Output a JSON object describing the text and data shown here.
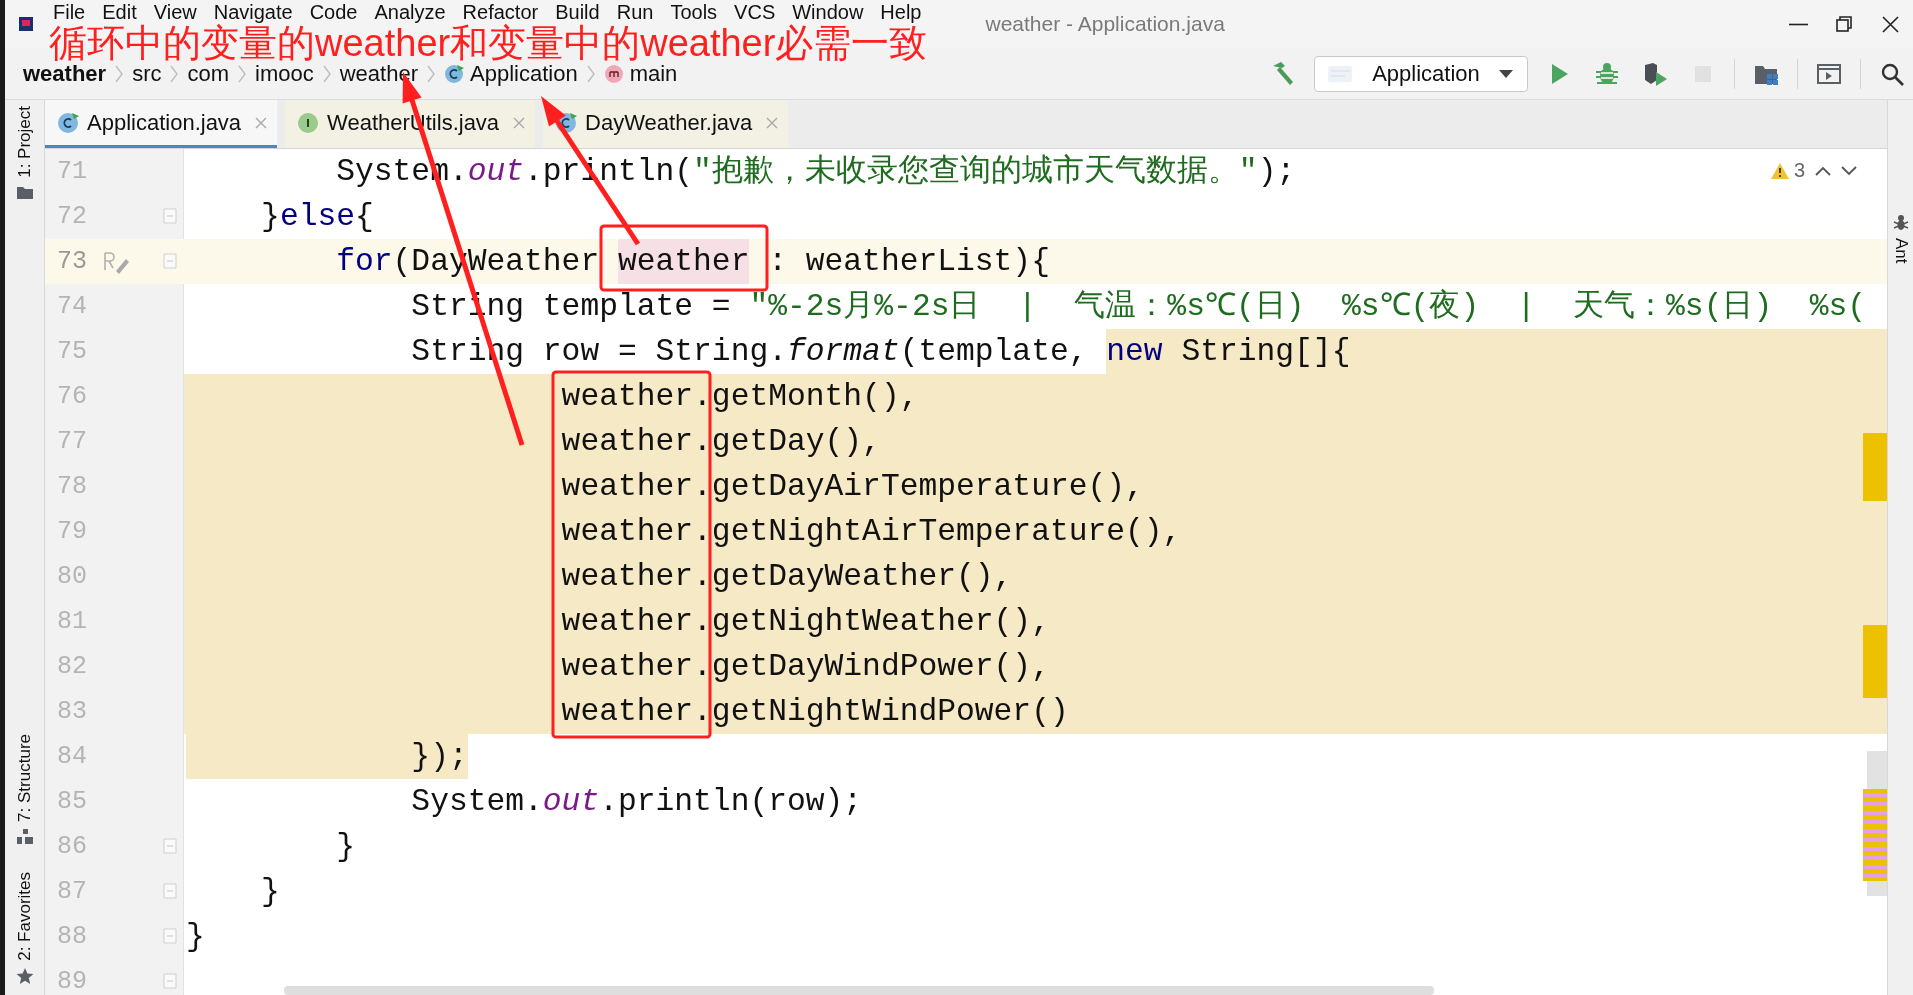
{
  "window": {
    "title": "weather - Application.java"
  },
  "menu": [
    "File",
    "Edit",
    "View",
    "Navigate",
    "Code",
    "Analyze",
    "Refactor",
    "Build",
    "Run",
    "Tools",
    "VCS",
    "Window",
    "Help"
  ],
  "annotation": {
    "text": "循环中的变量的weather和变量中的weather必需一致"
  },
  "breadcrumbs": [
    {
      "label": "weather",
      "kind": "project"
    },
    {
      "label": "src",
      "kind": "folder"
    },
    {
      "label": "com",
      "kind": "folder"
    },
    {
      "label": "imooc",
      "kind": "folder"
    },
    {
      "label": "weather",
      "kind": "folder"
    },
    {
      "label": "Application",
      "kind": "class"
    },
    {
      "label": "main",
      "kind": "method"
    }
  ],
  "toolbar": {
    "run_configuration": "Application",
    "actions": [
      {
        "kind": "build",
        "disabled": false
      },
      {
        "kind": "run",
        "disabled": false
      },
      {
        "kind": "debug",
        "disabled": false
      },
      {
        "kind": "coverage",
        "disabled": false
      },
      {
        "kind": "stop",
        "disabled": true
      },
      {
        "kind": "project_structure",
        "disabled": false
      },
      {
        "kind": "window",
        "disabled": false
      },
      {
        "kind": "search",
        "disabled": false
      }
    ]
  },
  "tool_windows_left": {
    "top": [
      {
        "label": "1: Project",
        "kind": "project"
      }
    ],
    "bottom": [
      {
        "label": "7: Structure",
        "kind": "structure"
      },
      {
        "label": "2: Favorites",
        "kind": "favorites"
      }
    ]
  },
  "tool_windows_right": [
    {
      "label": "Ant",
      "kind": "ant"
    }
  ],
  "tabs": [
    {
      "label": "Application.java",
      "kind": "class",
      "selected": true
    },
    {
      "label": "WeatherUtils.java",
      "kind": "interface",
      "selected": false
    },
    {
      "label": "DayWeather.java",
      "kind": "class",
      "selected": false
    }
  ],
  "inspections": {
    "warnings": "3"
  },
  "editor": {
    "lines": [
      {
        "number": "71",
        "segments": [
          {
            "text": "        System.",
            "kind": "plain"
          },
          {
            "text": "out",
            "kind": "field"
          },
          {
            "text": ".println(",
            "kind": "plain"
          },
          {
            "text": "\"抱歉，未收录您查询的城市天气数据。\"",
            "kind": "string"
          },
          {
            "text": ");",
            "kind": "plain"
          }
        ]
      },
      {
        "number": "72",
        "fold": true,
        "segments": [
          {
            "text": "    }",
            "kind": "plain"
          },
          {
            "text": "else",
            "kind": "keyword"
          },
          {
            "text": "{",
            "kind": "plain"
          }
        ]
      },
      {
        "number": "73",
        "fold": true,
        "current": true,
        "segments": [
          {
            "text": "        for",
            "kind": "keyword"
          },
          {
            "text": "(DayWeather ",
            "kind": "plain"
          },
          {
            "text": "weather",
            "kind": "plain",
            "marked": true
          },
          {
            "text": " : weatherList){",
            "kind": "plain"
          }
        ]
      },
      {
        "number": "74",
        "segments": [
          {
            "text": "            String template = ",
            "kind": "plain"
          },
          {
            "text": "\"%-2s月%-2s日  |  气温：%s℃(日)  %s℃(夜)  |  天气：%s(日)  %s(",
            "kind": "string"
          }
        ]
      },
      {
        "number": "75",
        "highlight_rest": true,
        "segments": [
          {
            "text": "            String row = String.",
            "kind": "plain"
          },
          {
            "text": "format",
            "kind": "method"
          },
          {
            "text": "(template, ",
            "kind": "plain"
          },
          {
            "text": "new",
            "kind": "keyword",
            "highlighted": true
          },
          {
            "text": " String[]{",
            "kind": "plain",
            "highlighted": true
          }
        ]
      },
      {
        "number": "76",
        "highlighted": true,
        "segments": [
          {
            "text": "                    weather.getMonth(),",
            "kind": "plain"
          }
        ]
      },
      {
        "number": "77",
        "highlighted": true,
        "segments": [
          {
            "text": "                    weather.getDay(),",
            "kind": "plain"
          }
        ]
      },
      {
        "number": "78",
        "highlighted": true,
        "segments": [
          {
            "text": "                    weather.getDayAirTemperature(),",
            "kind": "plain"
          }
        ]
      },
      {
        "number": "79",
        "highlighted": true,
        "segments": [
          {
            "text": "                    weather.getNightAirTemperature(),",
            "kind": "plain"
          }
        ]
      },
      {
        "number": "80",
        "highlighted": true,
        "segments": [
          {
            "text": "                    weather.getDayWeather(),",
            "kind": "plain"
          }
        ]
      },
      {
        "number": "81",
        "highlighted": true,
        "segments": [
          {
            "text": "                    weather.getNightWeather(),",
            "kind": "plain"
          }
        ]
      },
      {
        "number": "82",
        "highlighted": true,
        "segments": [
          {
            "text": "                    weather.getDayWindPower(),",
            "kind": "plain"
          }
        ]
      },
      {
        "number": "83",
        "highlighted": true,
        "segments": [
          {
            "text": "                    weather.getNightWindPower()",
            "kind": "plain"
          }
        ]
      },
      {
        "number": "84",
        "segments": [
          {
            "text": "            });",
            "kind": "plain",
            "highlighted": true
          }
        ]
      },
      {
        "number": "85",
        "segments": [
          {
            "text": "            System.",
            "kind": "plain"
          },
          {
            "text": "out",
            "kind": "field"
          },
          {
            "text": ".println(row);",
            "kind": "plain"
          }
        ]
      },
      {
        "number": "86",
        "fold": true,
        "segments": [
          {
            "text": "        }",
            "kind": "plain"
          }
        ]
      },
      {
        "number": "87",
        "fold": true,
        "segments": [
          {
            "text": "    }",
            "kind": "plain"
          }
        ]
      },
      {
        "number": "88",
        "fold": true,
        "segments": [
          {
            "text": "}",
            "kind": "plain"
          }
        ]
      },
      {
        "number": "89",
        "fold": true
      }
    ]
  }
}
